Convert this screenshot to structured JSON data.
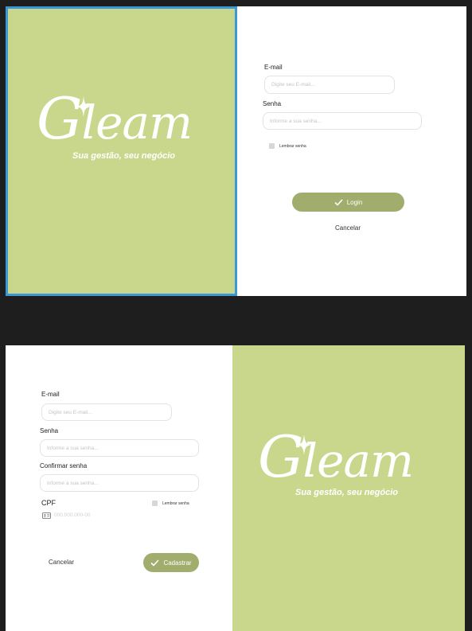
{
  "brand": {
    "logo_text": "Gleam",
    "tagline": "Sua gestão, seu negócio",
    "panel_color": "#c9d78c",
    "button_color": "#a1ad6d",
    "selection_color": "#3a98d8"
  },
  "login": {
    "email_label": "E-mail",
    "email_placeholder": "Digite seu E-mail...",
    "password_label": "Senha",
    "password_placeholder": "Informe a sua senha...",
    "remember_label": "Lembrar senha",
    "login_button": "Login",
    "cancel_button": "Cancelar"
  },
  "register": {
    "email_label": "E-mail",
    "email_placeholder": "Digite seu E-mail...",
    "password_label": "Senha",
    "password_placeholder": "Informe a sua senha...",
    "confirm_label": "Confirmar senha",
    "confirm_placeholder": "Informe a sua senha...",
    "cpf_label": "CPF",
    "cpf_placeholder": "000.000.000-00",
    "remember_label": "Lembrar senha",
    "cancel_button": "Cancelar",
    "submit_button": "Cadastrar"
  },
  "icons": [
    "sparkle-icon",
    "check-icon",
    "id-card-icon"
  ]
}
